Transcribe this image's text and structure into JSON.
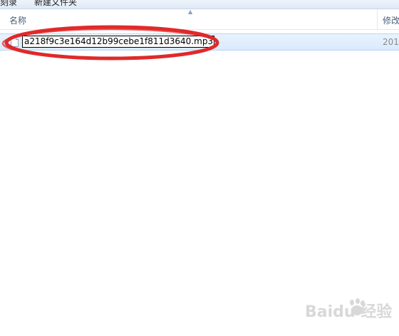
{
  "toolbar": {
    "left_label": "刻录",
    "new_folder_label": "新建文件夹"
  },
  "columns": {
    "name": "名称",
    "modified": "修改"
  },
  "file": {
    "name_value": "a218f9c3e164d12b99cebe1f811d3640.mp3",
    "date_partial": "201"
  },
  "annotation": {
    "color": "#e02a2a"
  },
  "watermark": {
    "text": "Baidu 经验"
  },
  "colors": {
    "selection": "#d9eafc",
    "header_text": "#4c607a"
  }
}
